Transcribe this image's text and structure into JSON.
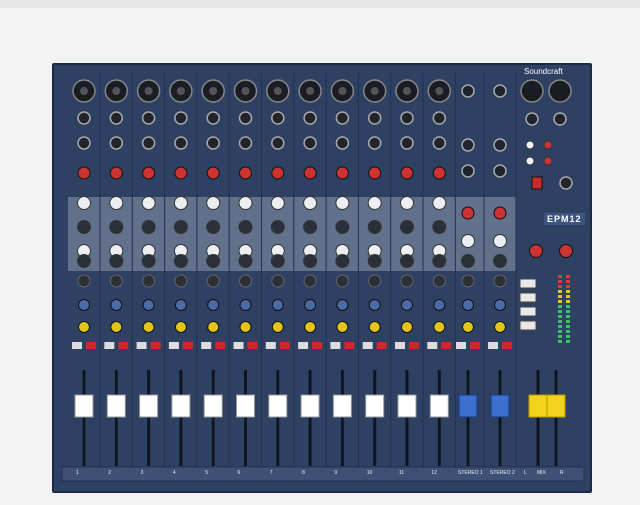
{
  "brand": {
    "name": "Soundcraft",
    "model": "EPM12"
  },
  "channels": {
    "mono": [
      "1",
      "2",
      "3",
      "4",
      "5",
      "6",
      "7",
      "8",
      "9",
      "10",
      "11",
      "12"
    ],
    "stereo": [
      "STEREO 1",
      "STEREO 2"
    ],
    "master": [
      "L",
      "MIX",
      "R"
    ]
  },
  "colors": {
    "background": "#f3f3f3",
    "panel": "#2f4163",
    "eq_section": "#8a97ad",
    "gain_knob": "#cc3333",
    "aux_knob": "#4a6aa8",
    "pan_knob": "#e2c51a",
    "fader_cap_mono": "#ffffff",
    "fader_cap_stereo": "#3b6fd0",
    "fader_cap_master": "#f2d21a",
    "meter_green": "#39c26a",
    "meter_red": "#e03a3a"
  },
  "icons": [
    "xlr-input-icon",
    "jack-input-icon",
    "knob-icon",
    "fader-icon",
    "mute-button-icon",
    "level-meter-icon",
    "headphone-icon"
  ]
}
